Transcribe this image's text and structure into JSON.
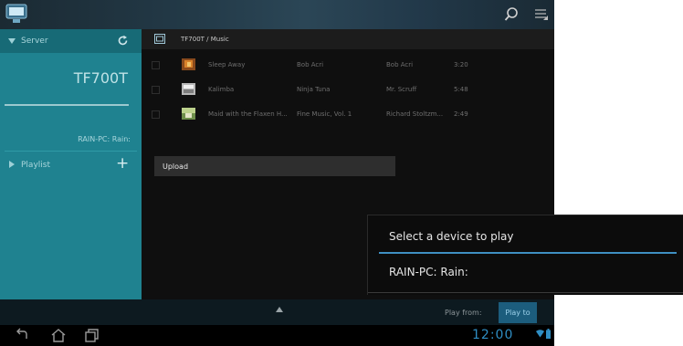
{
  "header": {
    "app_icon": "media-server-icon",
    "search_icon": "search-icon",
    "menu_icon": "overflow-menu-icon"
  },
  "sidebar": {
    "server_label": "Server",
    "device_name": "TF700T",
    "source_name": "RAIN-PC: Rain:",
    "playlist_label": "Playlist",
    "add_label": "+"
  },
  "content": {
    "breadcrumb": "TF700T / Music",
    "tracks": [
      {
        "title": "Sleep Away",
        "album": "Bob Acri",
        "artist": "Bob Acri",
        "duration": "3:20"
      },
      {
        "title": "Kalimba",
        "album": "Ninja Tuna",
        "artist": "Mr. Scruff",
        "duration": "5:48"
      },
      {
        "title": "Maid with the Flaxen H...",
        "album": "Fine Music, Vol. 1",
        "artist": "Richard Stoltzm...",
        "duration": "2:49"
      }
    ],
    "context_menu": {
      "upload_label": "Upload"
    }
  },
  "bottom_bar": {
    "play_from_label": "Play from:",
    "play_to_label": "Play to"
  },
  "system_bar": {
    "clock": "12:00"
  },
  "dialog": {
    "title": "Select a device to play",
    "option": "RAIN-PC: Rain:"
  },
  "colors": {
    "accent": "#1f8290",
    "dialog_divider": "#3f8fc2",
    "clock": "#2f8ec4"
  }
}
